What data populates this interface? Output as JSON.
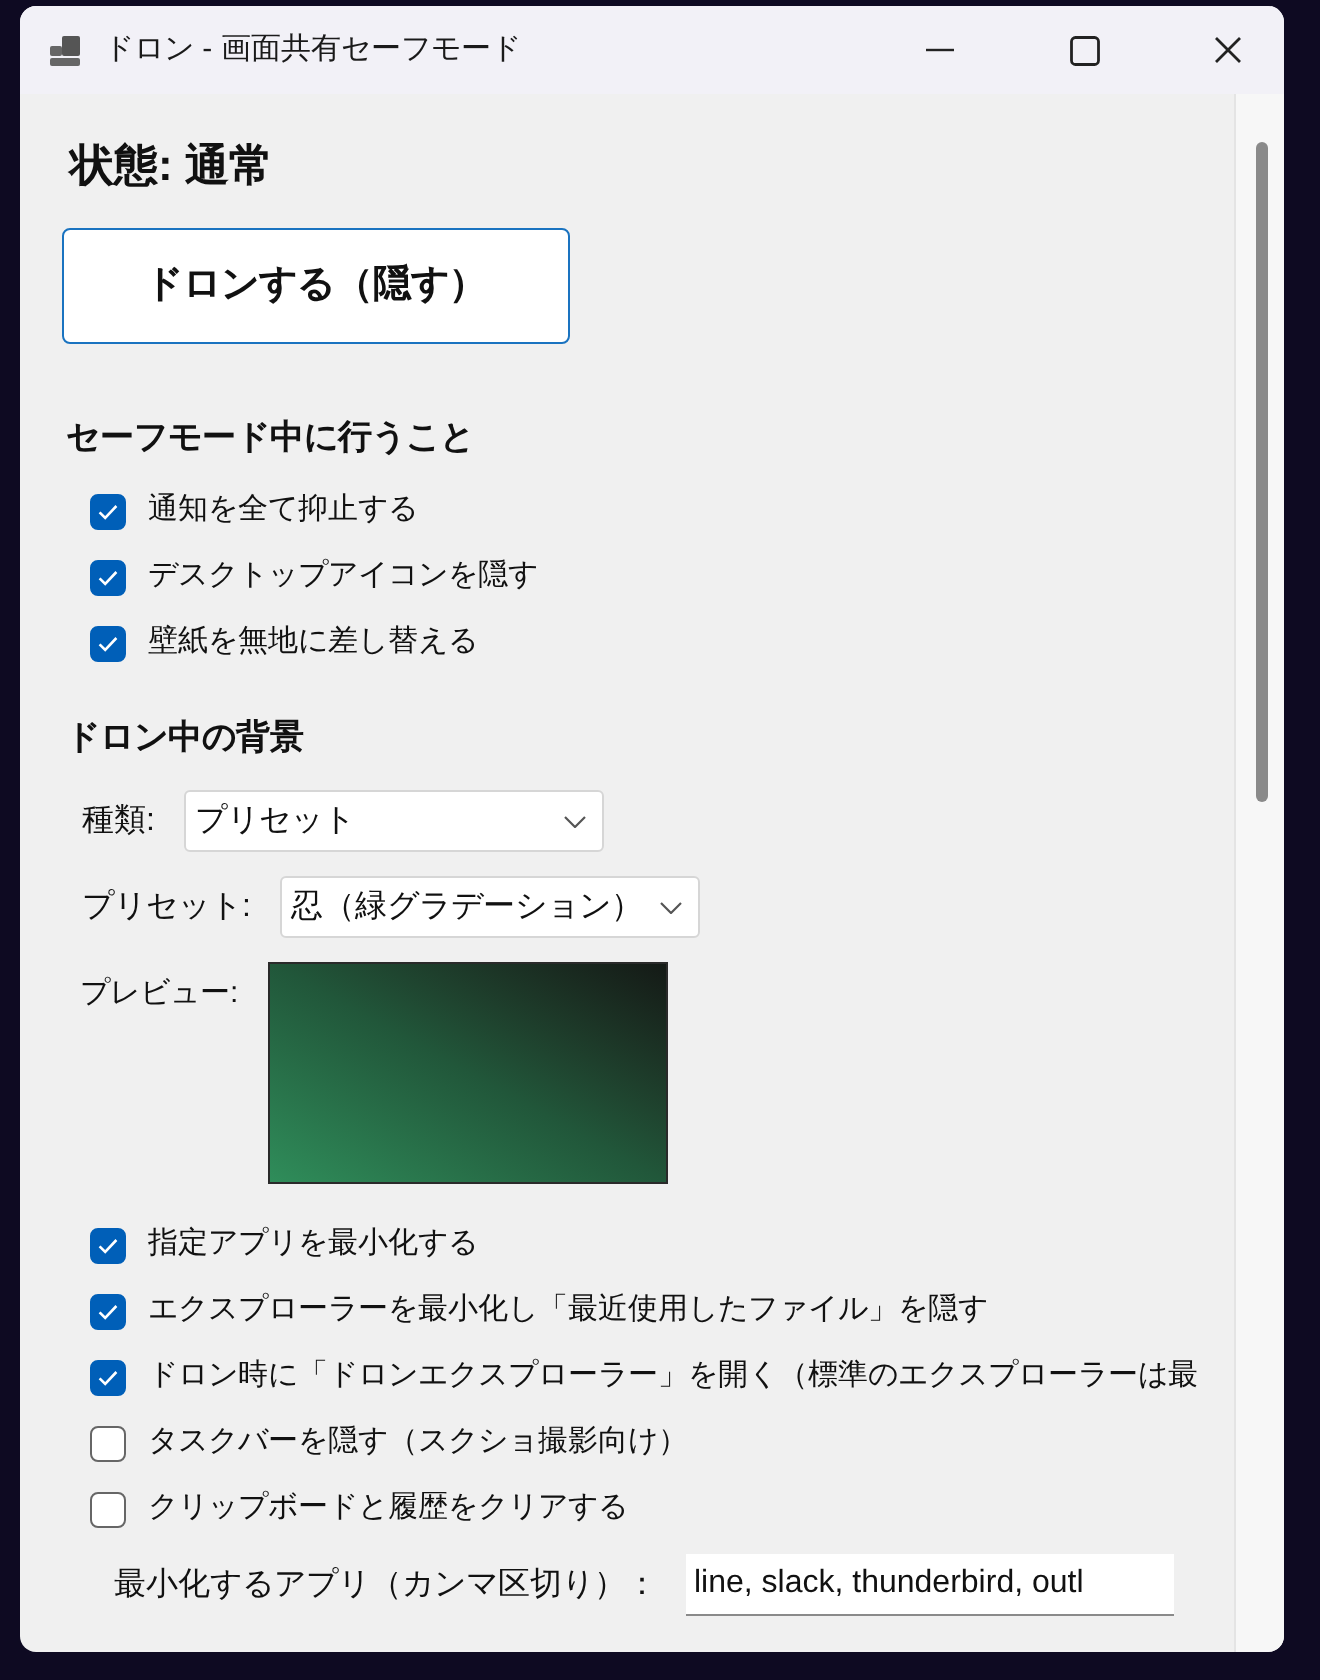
{
  "window": {
    "title": "ドロン - 画面共有セーフモード"
  },
  "status": "状態: 通常",
  "hide_button": {
    "label": "ドロンする（隠す）"
  },
  "safe_mode_actions": {
    "heading": "セーフモード中に行うこと",
    "options": [
      {
        "label": "通知を全て抑止する",
        "checked": true
      },
      {
        "label": "デスクトップアイコンを隠す",
        "checked": true
      },
      {
        "label": "壁紙を無地に差し替える",
        "checked": true
      }
    ]
  },
  "background": {
    "heading": "ドロン中の背景",
    "dropdowns": [
      {
        "label": "種類:",
        "value": "プリセット"
      },
      {
        "label": "プリセット:",
        "value": "忍（緑グラデーション）"
      }
    ],
    "preview": {
      "label": "プレビュー:"
    }
  },
  "options": [
    {
      "label": "指定アプリを最小化する",
      "checked": true
    },
    {
      "label": "エクスプローラーを最小化し「最近使用したファイル」を隠す",
      "checked": true
    },
    {
      "label": "ドロン時に「ドロンエクスプローラー」を開く（標準のエクスプローラーは最",
      "checked": true
    },
    {
      "label": "タスクバーを隠す（スクショ撮影向け）",
      "checked": false
    },
    {
      "label": "クリップボードと履歴をクリアする",
      "checked": false
    }
  ],
  "apps_field": {
    "label": "最小化するアプリ（カンマ区切り）：",
    "value": "line, slack, thunderbird, outl"
  }
}
